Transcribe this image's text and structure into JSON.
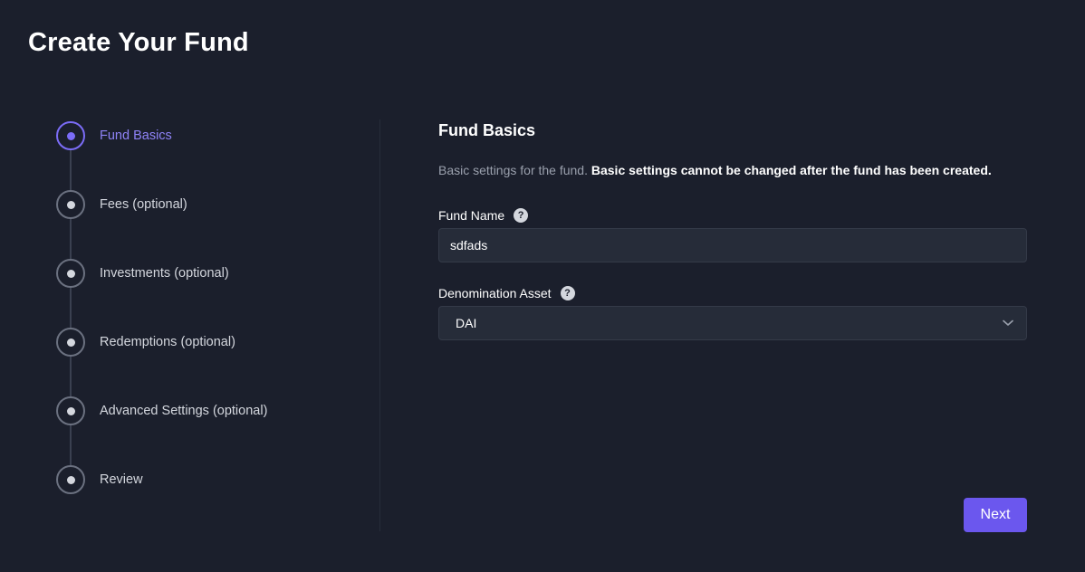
{
  "page": {
    "title": "Create Your Fund"
  },
  "stepper": {
    "steps": [
      {
        "label": "Fund Basics",
        "active": true
      },
      {
        "label": "Fees (optional)",
        "active": false
      },
      {
        "label": "Investments (optional)",
        "active": false
      },
      {
        "label": "Redemptions (optional)",
        "active": false
      },
      {
        "label": "Advanced Settings (optional)",
        "active": false
      },
      {
        "label": "Review",
        "active": false
      }
    ]
  },
  "form": {
    "section_title": "Fund Basics",
    "description": "Basic settings for the fund.",
    "description_emphasis": "Basic settings cannot be changed after the fund has been created.",
    "fund_name": {
      "label": "Fund Name",
      "value": "sdfads",
      "help_icon": "question-circle-icon"
    },
    "denomination_asset": {
      "label": "Denomination Asset",
      "value": "DAI",
      "help_icon": "question-circle-icon"
    }
  },
  "actions": {
    "next_label": "Next"
  },
  "colors": {
    "accent": "#6b57ee",
    "active_step": "#7b6cf6",
    "background": "#1b1f2c"
  }
}
